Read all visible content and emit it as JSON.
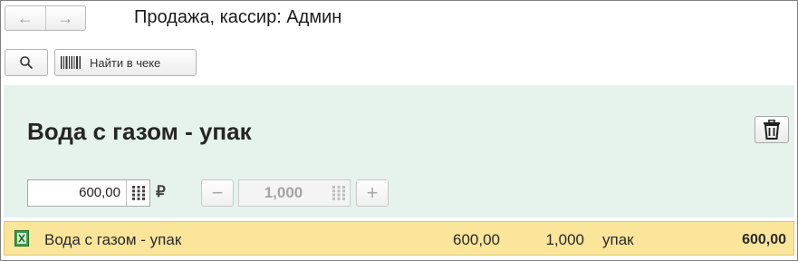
{
  "header": {
    "title": "Продажа, кассир: Админ",
    "back_icon": "arrow-left-icon",
    "forward_icon": "arrow-right-icon",
    "back_glyph": "←",
    "forward_glyph": "→"
  },
  "toolbar": {
    "search_icon": "search-icon",
    "find_in_receipt_label": "Найти в чеке",
    "barcode_icon": "barcode-icon"
  },
  "item": {
    "title": "Вода с газом - упак",
    "price": "600,00",
    "currency": "₽",
    "quantity": "1,000",
    "minus_glyph": "−",
    "plus_glyph": "+",
    "delete_icon": "trash-icon"
  },
  "receipt_rows": [
    {
      "name": "Вода с газом - упак",
      "price": "600,00",
      "quantity": "1,000",
      "unit": "упак",
      "sum": "600,00",
      "icon": "product-icon"
    }
  ],
  "colors": {
    "panel_bg": "#e6f3ec",
    "row_highlight": "#fbe59b",
    "row_icon_green": "#3aa047"
  }
}
